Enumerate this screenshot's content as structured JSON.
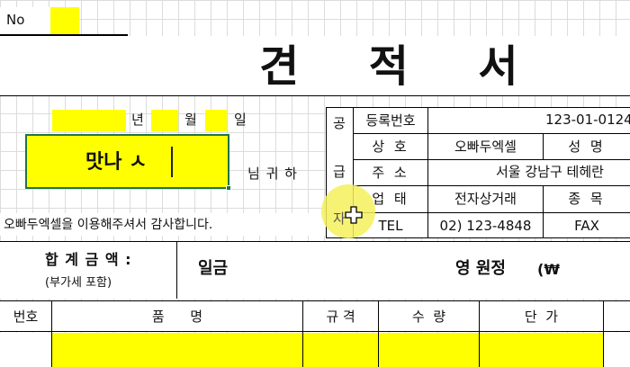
{
  "header": {
    "no_label": "No"
  },
  "title": "견     적     서",
  "date": {
    "year_label": "년",
    "month_label": "월",
    "day_label": "일"
  },
  "recipient": {
    "name": "맛나 ㅅ",
    "honorific": "님 귀 하"
  },
  "thanks_message": "오빠두엑셀을 이용해주셔서 감사합니다.",
  "supplier": {
    "side_label": {
      "c1": "공",
      "c2": "급",
      "c3": "자"
    },
    "reg_label": "등록번호",
    "reg_value": "123-01-0124",
    "trade_label": "상 호",
    "trade_value": "오빠두엑셀",
    "ceo_label": "성 명",
    "addr_label": "주 소",
    "addr_value": "서울 강남구 테헤란",
    "type_label": "업 태",
    "type_value": "전자상거래",
    "item_label": "종 목",
    "tel_label": "TEL",
    "tel_value": "02) 123-4848",
    "fax_label": "FAX"
  },
  "total": {
    "label": "합 계 금 액 :",
    "vat_note": "(부가세 포함)",
    "prefix": "일금",
    "suffix": "영 원정",
    "currency": "(₩"
  },
  "table": {
    "headers": [
      "번호",
      "품      명",
      "규 격",
      "수  량",
      "단  가"
    ]
  },
  "colors": {
    "highlight": "#ffff00",
    "selection_border": "#217346",
    "cursor_glow": "#f5f07a"
  }
}
